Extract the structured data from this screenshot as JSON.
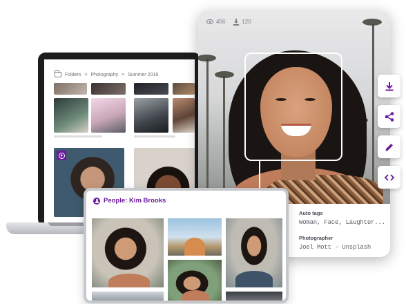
{
  "laptop": {
    "breadcrumb": {
      "items": [
        "Folders",
        "Photography",
        "Summer 2019"
      ],
      "separator": ">"
    }
  },
  "photo": {
    "stats": {
      "views": "456",
      "downloads": "120"
    },
    "meta": [
      {
        "label": "Auto tags",
        "value": "Woman, Face, Laughter..."
      },
      {
        "label": "Photographer",
        "value": "Joel Mott - Unsplash"
      }
    ]
  },
  "actions": [
    {
      "name": "download-icon"
    },
    {
      "name": "share-icon"
    },
    {
      "name": "edit-icon"
    },
    {
      "name": "embed-code-icon"
    }
  ],
  "people": {
    "title": "People: Kim Brooks"
  },
  "colors": {
    "accent": "#6a1b9a",
    "text_secondary": "#5f6269",
    "border": "#c6c7cb"
  }
}
